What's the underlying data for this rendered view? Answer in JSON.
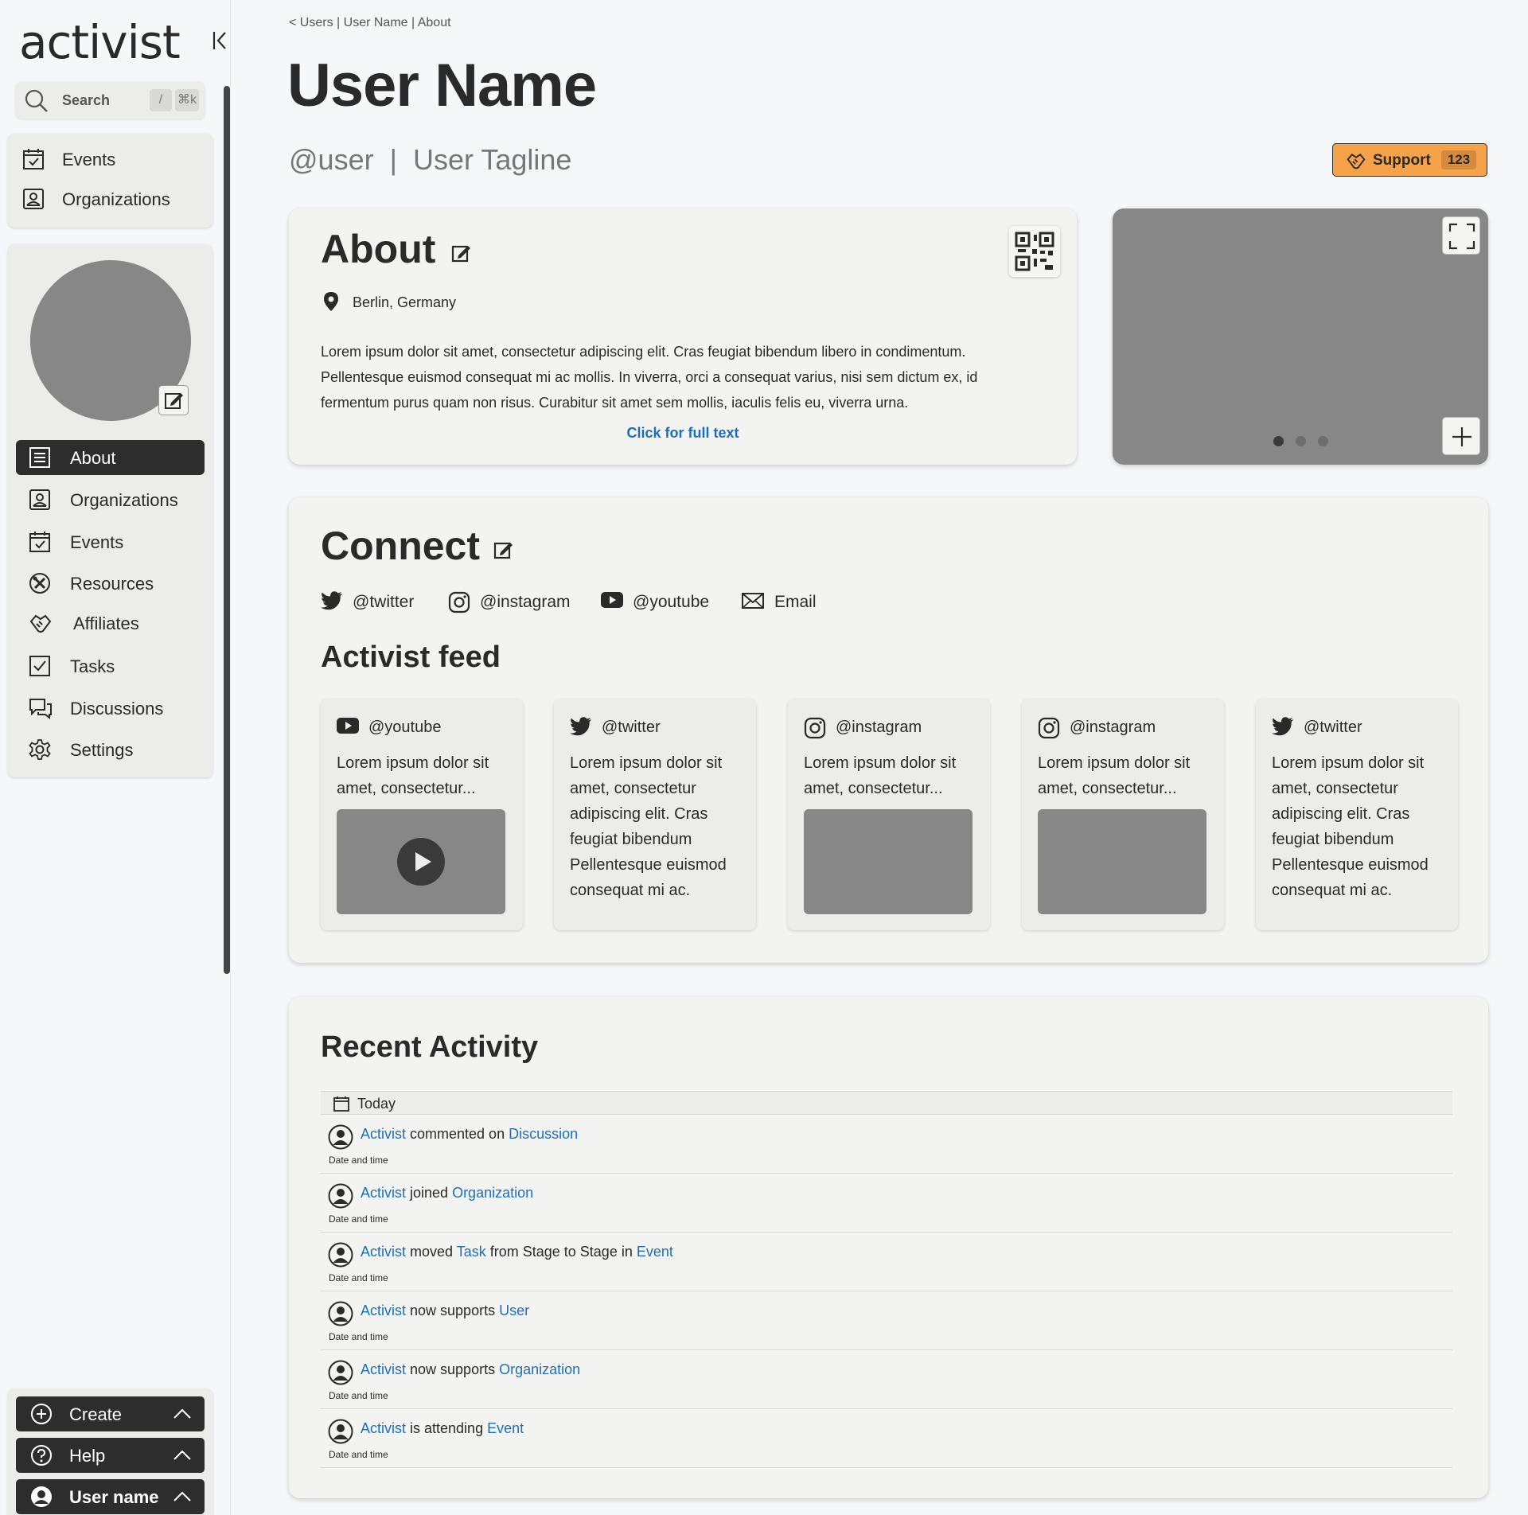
{
  "brand": {
    "logo_text": "activist"
  },
  "search": {
    "label": "Search",
    "shortcut_slash": "/",
    "shortcut_cmd": "⌘k"
  },
  "top_nav": [
    {
      "label": "Events",
      "icon": "calendar-check-icon"
    },
    {
      "label": "Organizations",
      "icon": "organization-icon"
    }
  ],
  "profile_nav": [
    {
      "label": "About",
      "icon": "document-lines-icon",
      "active": true
    },
    {
      "label": "Organizations",
      "icon": "organization-icon"
    },
    {
      "label": "Events",
      "icon": "calendar-check-icon"
    },
    {
      "label": "Resources",
      "icon": "tools-icon"
    },
    {
      "label": "Affiliates",
      "icon": "handshake-icon"
    },
    {
      "label": "Tasks",
      "icon": "checkbox-icon"
    },
    {
      "label": "Discussions",
      "icon": "chat-bubbles-icon"
    },
    {
      "label": "Settings",
      "icon": "gear-icon"
    }
  ],
  "bottom": {
    "create_label": "Create",
    "help_label": "Help",
    "user_label": "User name"
  },
  "breadcrumb": {
    "back": "<",
    "users": "Users",
    "sep": "|",
    "user": "User Name",
    "about": "About"
  },
  "header": {
    "title": "User Name",
    "handle": "@user",
    "divider": "|",
    "tagline": "User Tagline",
    "support_label": "Support",
    "support_count": "123"
  },
  "about": {
    "title": "About",
    "location": "Berlin, Germany",
    "text": "Lorem ipsum dolor sit amet, consectetur adipiscing elit. Cras feugiat bibendum libero in condimentum. Pellentesque euismod consequat mi ac mollis. In viverra, orci a consequat varius, nisi sem dictum ex, id fermentum purus quam non risus. Curabitur sit amet sem mollis, iaculis felis eu, viverra urna.",
    "full_text_link": "Click for full text"
  },
  "media": {
    "carousel_count": 3,
    "active_slide": 1
  },
  "connect": {
    "title": "Connect",
    "links": [
      {
        "label": "@twitter",
        "icon": "twitter-icon"
      },
      {
        "label": "@instagram",
        "icon": "instagram-icon"
      },
      {
        "label": "@youtube",
        "icon": "youtube-icon"
      },
      {
        "label": "Email",
        "icon": "envelope-icon"
      }
    ]
  },
  "feed": {
    "title": "Activist feed",
    "items": [
      {
        "handle": "@youtube",
        "icon": "youtube-icon",
        "text": "Lorem ipsum dolor sit amet, consectetur...",
        "media": "video"
      },
      {
        "handle": "@twitter",
        "icon": "twitter-icon",
        "text": "Lorem ipsum dolor sit amet, consectetur adipiscing elit. Cras feugiat bibendum Pellentesque euismod consequat mi ac.",
        "media": "none"
      },
      {
        "handle": "@instagram",
        "icon": "instagram-icon",
        "text": "Lorem ipsum dolor sit amet, consectetur...",
        "media": "image"
      },
      {
        "handle": "@instagram",
        "icon": "instagram-icon",
        "text": "Lorem ipsum dolor sit amet, consectetur...",
        "media": "image"
      },
      {
        "handle": "@twitter",
        "icon": "twitter-icon",
        "text": "Lorem ipsum dolor sit amet, consectetur adipiscing elit. Cras feugiat bibendum Pellentesque euismod consequat mi ac.",
        "media": "none"
      }
    ]
  },
  "activity": {
    "title": "Recent Activity",
    "day_label": "Today",
    "date_label": "Date and time",
    "rows": [
      {
        "actor": "Activist",
        "verb": " commented on ",
        "target": "Discussion"
      },
      {
        "actor": "Activist",
        "verb": " joined ",
        "target": "Organization"
      },
      {
        "actor": "Activist",
        "verb": " moved ",
        "target": "Task",
        "verb2": " from Stage to Stage in ",
        "target2": "Event"
      },
      {
        "actor": "Activist",
        "verb": " now supports ",
        "target": "User"
      },
      {
        "actor": "Activist",
        "verb": " now supports ",
        "target": "Organization"
      },
      {
        "actor": "Activist",
        "verb": " is attending ",
        "target": "Event"
      }
    ]
  },
  "colors": {
    "accent_orange": "#f5a24b",
    "link_blue": "#1e6fb8",
    "dark": "#2d2d2d",
    "placeholder_grey": "#878787"
  }
}
